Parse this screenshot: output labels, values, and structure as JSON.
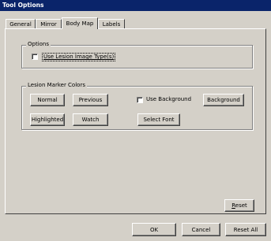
{
  "window": {
    "title": "Tool Options"
  },
  "tabs": [
    {
      "label": "General"
    },
    {
      "label": "Mirror"
    },
    {
      "label": "Body Map"
    },
    {
      "label": "Labels"
    }
  ],
  "active_tab": "Body Map",
  "options_group": {
    "label": "Options",
    "use_lesion_image_types": {
      "label": "Use Lesion Image Type(s)",
      "checked": false
    }
  },
  "lesion_marker_group": {
    "label": "Lesion Marker Colors",
    "buttons": {
      "normal": "Normal",
      "previous": "Previous",
      "highlighted": "Highlighted",
      "watch": "Watch",
      "background": "Background",
      "select_font": "Select Font"
    },
    "use_background": {
      "label": "Use Background",
      "checked": false
    }
  },
  "panel_buttons": {
    "reset": "Reset"
  },
  "footer": {
    "ok": "OK",
    "cancel": "Cancel",
    "reset_all": "Reset All"
  }
}
